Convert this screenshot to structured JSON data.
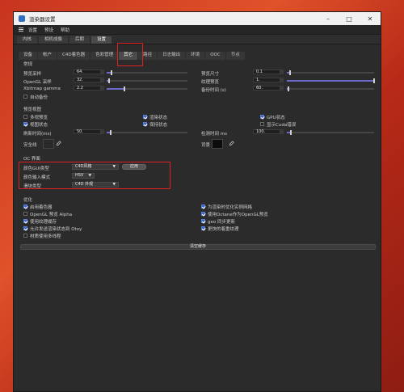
{
  "window": {
    "title": "渲染器设置"
  },
  "menu": [
    "设置",
    "预设",
    "帮助"
  ],
  "tabs1": [
    {
      "label": "内核"
    },
    {
      "label": "相机成像"
    },
    {
      "label": "后期"
    },
    {
      "label": "设置",
      "active": true
    }
  ],
  "tabs2": [
    {
      "label": "设备"
    },
    {
      "label": "帐户"
    },
    {
      "label": "C4D着色器"
    },
    {
      "label": "色彩管理"
    },
    {
      "label": "其它",
      "active": true
    },
    {
      "label": "路径"
    },
    {
      "label": "日志输出"
    },
    {
      "label": "环境"
    },
    {
      "label": "OOC"
    },
    {
      "label": "节点"
    }
  ],
  "general": {
    "title": "常规",
    "preview_sampling": {
      "label": "预览采样",
      "value": "64.",
      "fraction": 0.06
    },
    "preview_size": {
      "label": "预览尺寸",
      "value": "0.1",
      "fraction": 0.04
    },
    "opengl_sampling": {
      "label": "OpenGL 采样",
      "value": "32.",
      "fraction": 0.03
    },
    "texture_brightness": {
      "label": "纹理预览",
      "value": "1.",
      "fraction": 1.0
    },
    "xbitmap_gamma": {
      "label": "Xbitmap gamma",
      "value": "2.2",
      "fraction": 0.22
    },
    "backup_time": {
      "label": "备份时间 (s)",
      "value": "60.",
      "fraction": 0.02
    },
    "auto_backup": {
      "label": "自动备份",
      "checked": false
    }
  },
  "preview": {
    "title": "预览视图",
    "multi_preview": {
      "label": "多视预览",
      "checked": false
    },
    "render_state": {
      "label": "渲染状态",
      "checked": true
    },
    "gpu_state": {
      "label": "GPU状态",
      "checked": true
    },
    "preview_state": {
      "label": "视图状态",
      "checked": true
    },
    "keep_state": {
      "label": "保持状态",
      "checked": true
    },
    "show_cuda_errors": {
      "label": "显示Cuda错误",
      "checked": false
    },
    "refresh_time": {
      "label": "刷新时间(ms)",
      "value": "50.",
      "fraction": 0.05
    },
    "check_time": {
      "label": "检测时间 ms",
      "value": "100.",
      "fraction": 0.05
    },
    "safe_frame": {
      "label": "安全线"
    },
    "background": {
      "label": "背景"
    }
  },
  "oc_ui": {
    "title": "OC 界面",
    "gui_type": {
      "label": "颜色GUI类型",
      "value": "C4D风格"
    },
    "apply": "应用",
    "color_input_mode": {
      "label": "颜色输入模式",
      "value": "HSV"
    },
    "slider_type": {
      "label": "滑块类型",
      "value": "C4D 外观"
    }
  },
  "optimize": {
    "title": "优化",
    "left": [
      {
        "label": "启用着色器",
        "checked": true
      },
      {
        "label": "OpenGL 预览 Alpha",
        "checked": false
      },
      {
        "label": "使用纹理缓存",
        "checked": true
      },
      {
        "label": "允许发送渲染状态到 Otoy",
        "checked": true
      },
      {
        "label": "材质使用多线程",
        "checked": false
      }
    ],
    "right": [
      {
        "label": "为渲染时优化实例网格",
        "checked": true
      },
      {
        "label": "使用Octane作为OpenGL预览",
        "checked": true
      },
      {
        "label": "geo 同步更新",
        "checked": true
      },
      {
        "label": "更快的着重纹理",
        "checked": true
      }
    ],
    "clear_cache": "清空缓存"
  },
  "colors": {
    "accent": "#3a64c8",
    "slider": "#6a6ac8",
    "highlight": "#e02020"
  }
}
